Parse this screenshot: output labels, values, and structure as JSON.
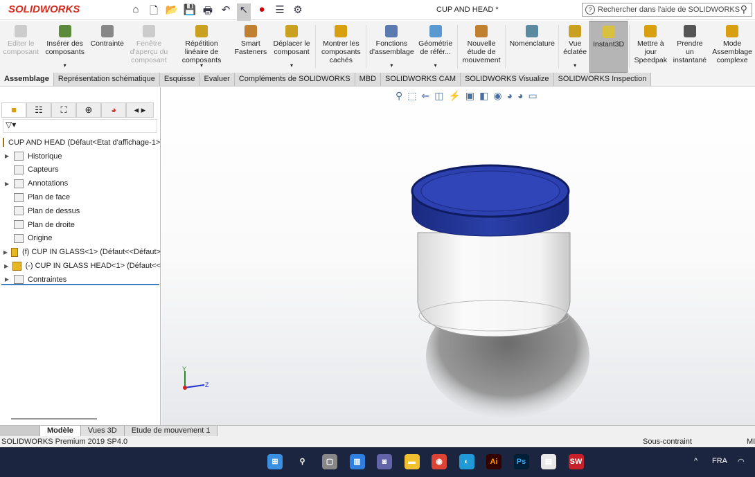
{
  "app": {
    "logo": "SOLIDWORKS",
    "title": "CUP AND HEAD *",
    "search_placeholder": "Rechercher dans l'aide de SOLIDWORKS"
  },
  "quick_access": [
    "home-icon",
    "new-icon",
    "open-icon",
    "save-icon",
    "print-icon",
    "undo-icon",
    "select-icon",
    "rebuild-icon",
    "file-properties-icon",
    "options-icon"
  ],
  "ribbon": [
    {
      "label": "Editer le composant",
      "disabled": true
    },
    {
      "label": "Insérer des composants",
      "dropdown": true
    },
    {
      "label": "Contrainte"
    },
    {
      "label": "Fenêtre d'aperçu du composant",
      "disabled": true
    },
    {
      "label": "Répétition linéaire de composants",
      "dropdown": true
    },
    {
      "label": "Smart Fasteners"
    },
    {
      "label": "Déplacer le composant",
      "dropdown": true
    },
    {
      "label": "Montrer les composants cachés"
    },
    {
      "label": "Fonctions d'assemblage",
      "dropdown": true
    },
    {
      "label": "Géométrie de référ...",
      "dropdown": true
    },
    {
      "label": "Nouvelle étude de mouvement"
    },
    {
      "label": "Nomenclature"
    },
    {
      "label": "Vue éclatée",
      "dropdown": true
    },
    {
      "label": "Instant3D",
      "active": true
    },
    {
      "label": "Mettre à jour Speedpak"
    },
    {
      "label": "Prendre un instantané"
    },
    {
      "label": "Mode Assemblage complexe"
    }
  ],
  "tabs": [
    "Assemblage",
    "Représentation schématique",
    "Esquisse",
    "Evaluer",
    "Compléments de SOLIDWORKS",
    "MBD",
    "SOLIDWORKS CAM",
    "SOLIDWORKS Visualize",
    "SOLIDWORKS Inspection"
  ],
  "view_toolbar": [
    "zoom-to-fit-icon",
    "zoom-to-area-icon",
    "previous-view-icon",
    "section-view-icon",
    "dynamic-annotation-icon",
    "view-orientation-icon",
    "display-style-icon",
    "hide-show-icon",
    "edit-appearance-icon",
    "apply-scene-icon",
    "view-settings-icon"
  ],
  "tree": {
    "root": "CUP AND HEAD  (Défaut<Etat d'affichage-1>)",
    "items": [
      {
        "label": "Historique",
        "expand": true
      },
      {
        "label": "Capteurs"
      },
      {
        "label": "Annotations",
        "expand": true
      },
      {
        "label": "Plan de face"
      },
      {
        "label": "Plan de dessus"
      },
      {
        "label": "Plan de droite"
      },
      {
        "label": "Origine"
      },
      {
        "label": "(f) CUP IN GLASS<1> (Défaut<<Défaut>",
        "expand": true,
        "component": true
      },
      {
        "label": "(-) CUP IN GLASS HEAD<1> (Défaut<<",
        "expand": true,
        "component": true
      },
      {
        "label": "Contraintes",
        "expand": true
      }
    ]
  },
  "triad": {
    "y": "Y",
    "z": "Z"
  },
  "bottom_tabs": [
    "Modèle",
    "Vues 3D",
    "Etude de mouvement 1"
  ],
  "status": {
    "left": "SOLIDWORKS Premium 2019 SP4.0",
    "state": "Sous-contraint",
    "units": "MI"
  },
  "taskbar": {
    "apps": [
      "Windows",
      "Recherche",
      "Vue des tâches",
      "Widgets",
      "Teams",
      "Explorateur",
      "Chrome",
      "Edge",
      "Ai",
      "Ps",
      "Store",
      "SW 2019"
    ],
    "lang": "FRA"
  },
  "colors": {
    "lid": "#2a3fa8",
    "accent": "#3a7fc2",
    "taskbar": "#1c2540"
  }
}
